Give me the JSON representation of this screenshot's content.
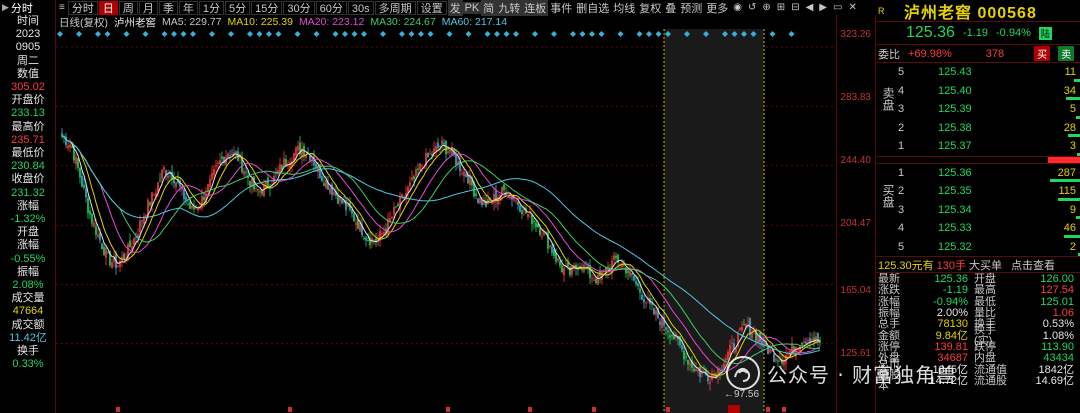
{
  "toolbar": {
    "menu_icon": "≡",
    "period_tabs": [
      "分时",
      "日",
      "周",
      "月",
      "季",
      "年",
      "1分",
      "5分",
      "15分",
      "30分",
      "60分",
      "30s",
      "多周期",
      "设置"
    ],
    "active_index": 1,
    "right_items": [
      "发",
      "PK",
      "简",
      "九转",
      "连板",
      "事件",
      "删自选",
      "均线",
      "复权",
      "叠",
      "预测",
      "更多"
    ],
    "icons": [
      "eye-icon",
      "undo-icon",
      "search-icon",
      "zoom-in-icon",
      "zoom-out-icon",
      "arrow-left-icon",
      "arrow-right-icon",
      "window-icon",
      "close-icon"
    ]
  },
  "ma_line": {
    "title": "日线(复权)",
    "stock": "泸州老窖",
    "ma5": "MA5: 229.77",
    "ma10": "MA10: 225.39",
    "ma20": "MA20: 223.12",
    "ma30": "MA30: 224.67",
    "ma60": "MA60: 217.14"
  },
  "left_info": {
    "header": "分时",
    "rows": [
      {
        "text": "时间",
        "cls": "v-white"
      },
      {
        "text": "2023",
        "cls": "v-white"
      },
      {
        "text": "0905",
        "cls": "v-white"
      },
      {
        "text": "周二",
        "cls": "v-white"
      },
      {
        "text": "数值",
        "cls": "v-white"
      },
      {
        "text": "305.02",
        "cls": "v-red"
      },
      {
        "text": "开盘价",
        "cls": "v-white"
      },
      {
        "text": "233.13",
        "cls": "v-green"
      },
      {
        "text": "最高价",
        "cls": "v-white"
      },
      {
        "text": "235.71",
        "cls": "v-red"
      },
      {
        "text": "最低价",
        "cls": "v-white"
      },
      {
        "text": "230.84",
        "cls": "v-green"
      },
      {
        "text": "收盘价",
        "cls": "v-white"
      },
      {
        "text": "231.32",
        "cls": "v-green"
      },
      {
        "text": "涨幅",
        "cls": "v-white"
      },
      {
        "text": "-1.32%",
        "cls": "v-green"
      },
      {
        "text": "开盘",
        "cls": "v-white"
      },
      {
        "text": "涨幅",
        "cls": "v-white"
      },
      {
        "text": "-0.55%",
        "cls": "v-green"
      },
      {
        "text": "振幅",
        "cls": "v-white"
      },
      {
        "text": "2.08%",
        "cls": "v-green"
      },
      {
        "text": "成交量",
        "cls": "v-white"
      },
      {
        "text": "47664",
        "cls": "v-yellow"
      },
      {
        "text": "成交额",
        "cls": "v-white"
      },
      {
        "text": "11.42亿",
        "cls": "v-cyan"
      },
      {
        "text": "换手",
        "cls": "v-white"
      },
      {
        "text": "0.33%",
        "cls": "v-green"
      }
    ]
  },
  "price_axis": [
    "323.26",
    "283.83",
    "244.40",
    "204.47",
    "165.04",
    "125.61"
  ],
  "chart_annotations": {
    "low_label": "97.56"
  },
  "stock_panel": {
    "r_mark": "R",
    "name": "泸州老窖 000568",
    "price": "125.36",
    "change": "-1.19",
    "change_pct": "-0.94%",
    "badge": "陆",
    "weibi_label": "委比",
    "weibi_pct": "+69.98%",
    "weibi_val": "378",
    "buy_btn": "买",
    "sell_btn": "卖",
    "sell_label": "卖盘",
    "buy_label": "买盘",
    "asks": [
      {
        "lv": "5",
        "price": "125.43",
        "vol": "11",
        "bar": 6
      },
      {
        "lv": "4",
        "price": "125.40",
        "vol": "34",
        "bar": 14
      },
      {
        "lv": "3",
        "price": "125.39",
        "vol": "5",
        "bar": 4
      },
      {
        "lv": "2",
        "price": "125.38",
        "vol": "28",
        "bar": 12
      },
      {
        "lv": "1",
        "price": "125.37",
        "vol": "3",
        "bar": 3
      }
    ],
    "bids": [
      {
        "lv": "1",
        "price": "125.36",
        "vol": "287",
        "bar": 30
      },
      {
        "lv": "2",
        "price": "125.35",
        "vol": "115",
        "bar": 22
      },
      {
        "lv": "3",
        "price": "125.34",
        "vol": "9",
        "bar": 4
      },
      {
        "lv": "4",
        "price": "125.33",
        "vol": "46",
        "bar": 16
      },
      {
        "lv": "5",
        "price": "125.32",
        "vol": "2",
        "bar": 2
      }
    ],
    "summary": {
      "a": "125.30元有",
      "b": "130手",
      "c": "大买单",
      "d": "点击查看"
    },
    "stats": [
      {
        "k1": "最新",
        "v1": "125.36",
        "c1": "g",
        "k2": "开盘",
        "v2": "126.00",
        "c2": "g"
      },
      {
        "k1": "涨跌",
        "v1": "-1.19",
        "c1": "g",
        "k2": "最高",
        "v2": "127.54",
        "c2": "r"
      },
      {
        "k1": "涨幅",
        "v1": "-0.94%",
        "c1": "g",
        "k2": "最低",
        "v2": "125.01",
        "c2": "g"
      },
      {
        "k1": "振幅",
        "v1": "2.00%",
        "c1": "w",
        "k2": "量比",
        "v2": "1.06",
        "c2": "r"
      },
      {
        "k1": "总手",
        "v1": "78130",
        "c1": "y",
        "k2": "换手",
        "v2": "0.53%",
        "c2": "w"
      },
      {
        "k1": "金额",
        "v1": "9.84亿",
        "c1": "y",
        "k2": "换手(实)",
        "v2": "1.08%",
        "c2": "w"
      },
      {
        "k1": "涨停",
        "v1": "139.81",
        "c1": "r",
        "k2": "跌停",
        "v2": "113.90",
        "c2": "g"
      },
      {
        "k1": "外盘",
        "v1": "34687",
        "c1": "r",
        "k2": "内盘",
        "v2": "43434",
        "c2": "g"
      },
      {
        "k1": "总市值",
        "v1": "1845亿",
        "c1": "w",
        "k2": "流通值",
        "v2": "1842亿",
        "c2": "w"
      },
      {
        "k1": "总股本",
        "v1": "14.72亿",
        "c1": "w",
        "k2": "流通股",
        "v2": "14.69亿",
        "c2": "w"
      }
    ]
  },
  "watermark": "公众号 · 财富独角兽",
  "colors": {
    "up": "#ff3b3b",
    "down": "#1ed760",
    "ma5": "#e6e6e6",
    "ma10": "#e6d200",
    "ma20": "#e64ad2",
    "ma30": "#3ecf6a",
    "ma60": "#4fc9e6"
  },
  "chart_data": {
    "type": "candlestick",
    "ylim": [
      90,
      330
    ],
    "close_trajectory": [
      264,
      258,
      236,
      212,
      196,
      182,
      178,
      186,
      198,
      214,
      226,
      242,
      238,
      226,
      214,
      220,
      232,
      246,
      254,
      250,
      238,
      226,
      230,
      236,
      246,
      252,
      256,
      250,
      238,
      230,
      222,
      214,
      206,
      196,
      194,
      202,
      214,
      224,
      234,
      246,
      252,
      258,
      254,
      244,
      236,
      222,
      218,
      224,
      228,
      222,
      214,
      208,
      200,
      188,
      176,
      172,
      180,
      172,
      168,
      176,
      182,
      176,
      166,
      156,
      146,
      140,
      132,
      122,
      112,
      106,
      104,
      108,
      118,
      128,
      138,
      132,
      124,
      118,
      116,
      122,
      128,
      130,
      126
    ]
  }
}
